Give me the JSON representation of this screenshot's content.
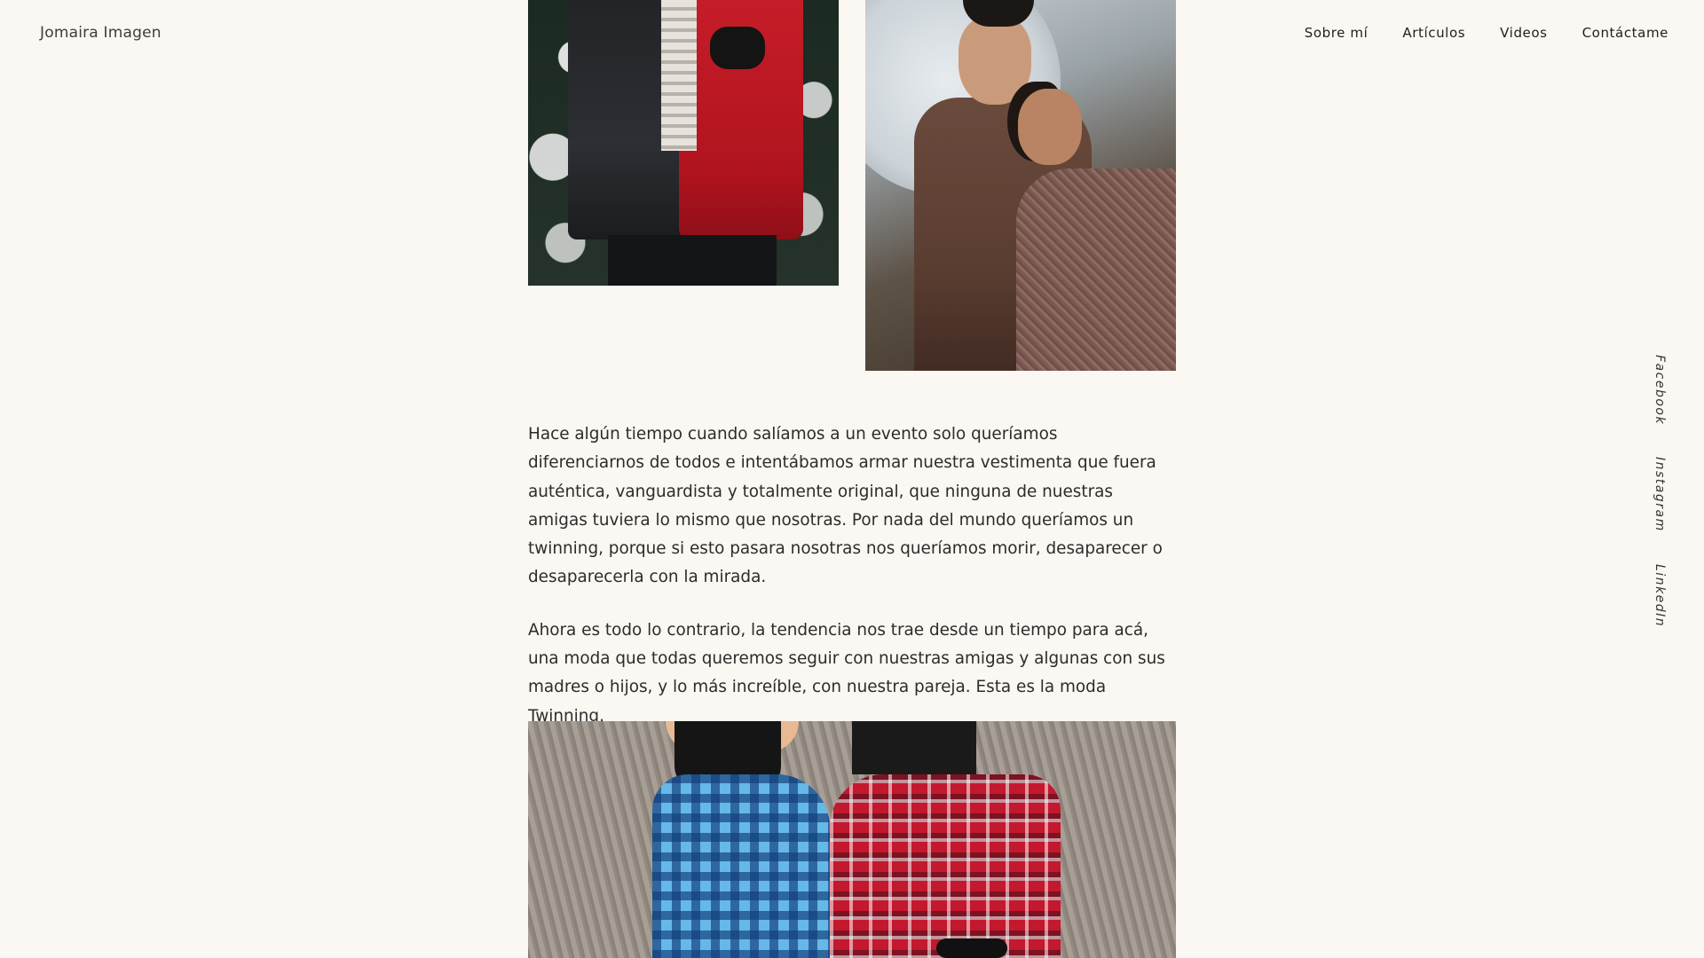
{
  "header": {
    "brand": "Jomaira Imagen",
    "nav": [
      {
        "label": "Sobre mí"
      },
      {
        "label": "Artículos"
      },
      {
        "label": "Videos"
      },
      {
        "label": "Contáctame"
      }
    ]
  },
  "social": [
    {
      "label": "Facebook"
    },
    {
      "label": "Instagram"
    },
    {
      "label": "LinkedIn"
    }
  ],
  "article": {
    "paragraphs": [
      "Hace algún tiempo cuando salíamos a un evento solo queríamos diferenciarnos de todos e intentábamos armar nuestra vestimenta que fuera auténtica, vanguardista y totalmente original, que ninguna de nuestras amigas tuviera lo mismo que nosotras. Por nada del mundo queríamos un twinning, porque si esto pasara nosotras nos queríamos morir, desaparecer o desaparecerla con la mirada.",
      "Ahora es todo lo contrario, la tendencia nos trae desde un tiempo para acá, una moda que todas queremos seguir con nuestras amigas y algunas con sus madres o hijos, y lo más increíble, con nuestra pareja. Esta es la moda Twinning."
    ]
  },
  "colors": {
    "background": "#fbf7f2",
    "text": "#2c2c2c"
  }
}
